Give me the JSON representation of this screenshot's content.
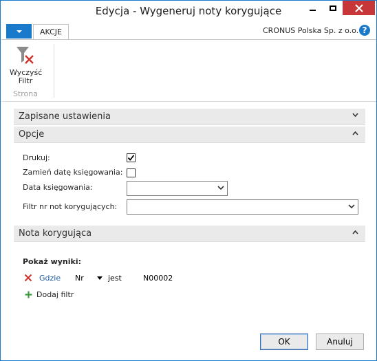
{
  "window": {
    "title": "Edycja - Wygeneruj noty korygujące"
  },
  "ribbon": {
    "tab_label": "AKCJE",
    "company": "CRONUS Polska Sp. z o.o.",
    "help_symbol": "?",
    "clear_filter_line1": "Wyczyść",
    "clear_filter_line2": "Filtr",
    "group_label": "Strona"
  },
  "sections": {
    "saved": "Zapisane ustawienia",
    "options": "Opcje",
    "correction_note": "Nota korygująca"
  },
  "options": {
    "print_label": "Drukuj:",
    "print_checked": true,
    "replace_date_label": "Zamień datę księgowania:",
    "replace_date_checked": false,
    "posting_date_label": "Data księgowania:",
    "posting_date_value": "",
    "note_filter_label": "Filtr nr not korygujących:",
    "note_filter_value": ""
  },
  "filters": {
    "show_results_label": "Pokaż wyniki:",
    "where_label": "Gdzie",
    "field": "Nr",
    "operator": "jest",
    "value": "N00002",
    "add_filter_label": "Dodaj filtr"
  },
  "buttons": {
    "ok": "OK",
    "cancel": "Anuluj"
  },
  "colors": {
    "accent": "#1979ca",
    "close": "#c7373a",
    "link": "#1f5fa8"
  },
  "icons": {
    "clear_filter": "funnel-with-red-x",
    "help": "question-circle",
    "remove_filter": "red-x",
    "add_filter": "green-plus"
  }
}
